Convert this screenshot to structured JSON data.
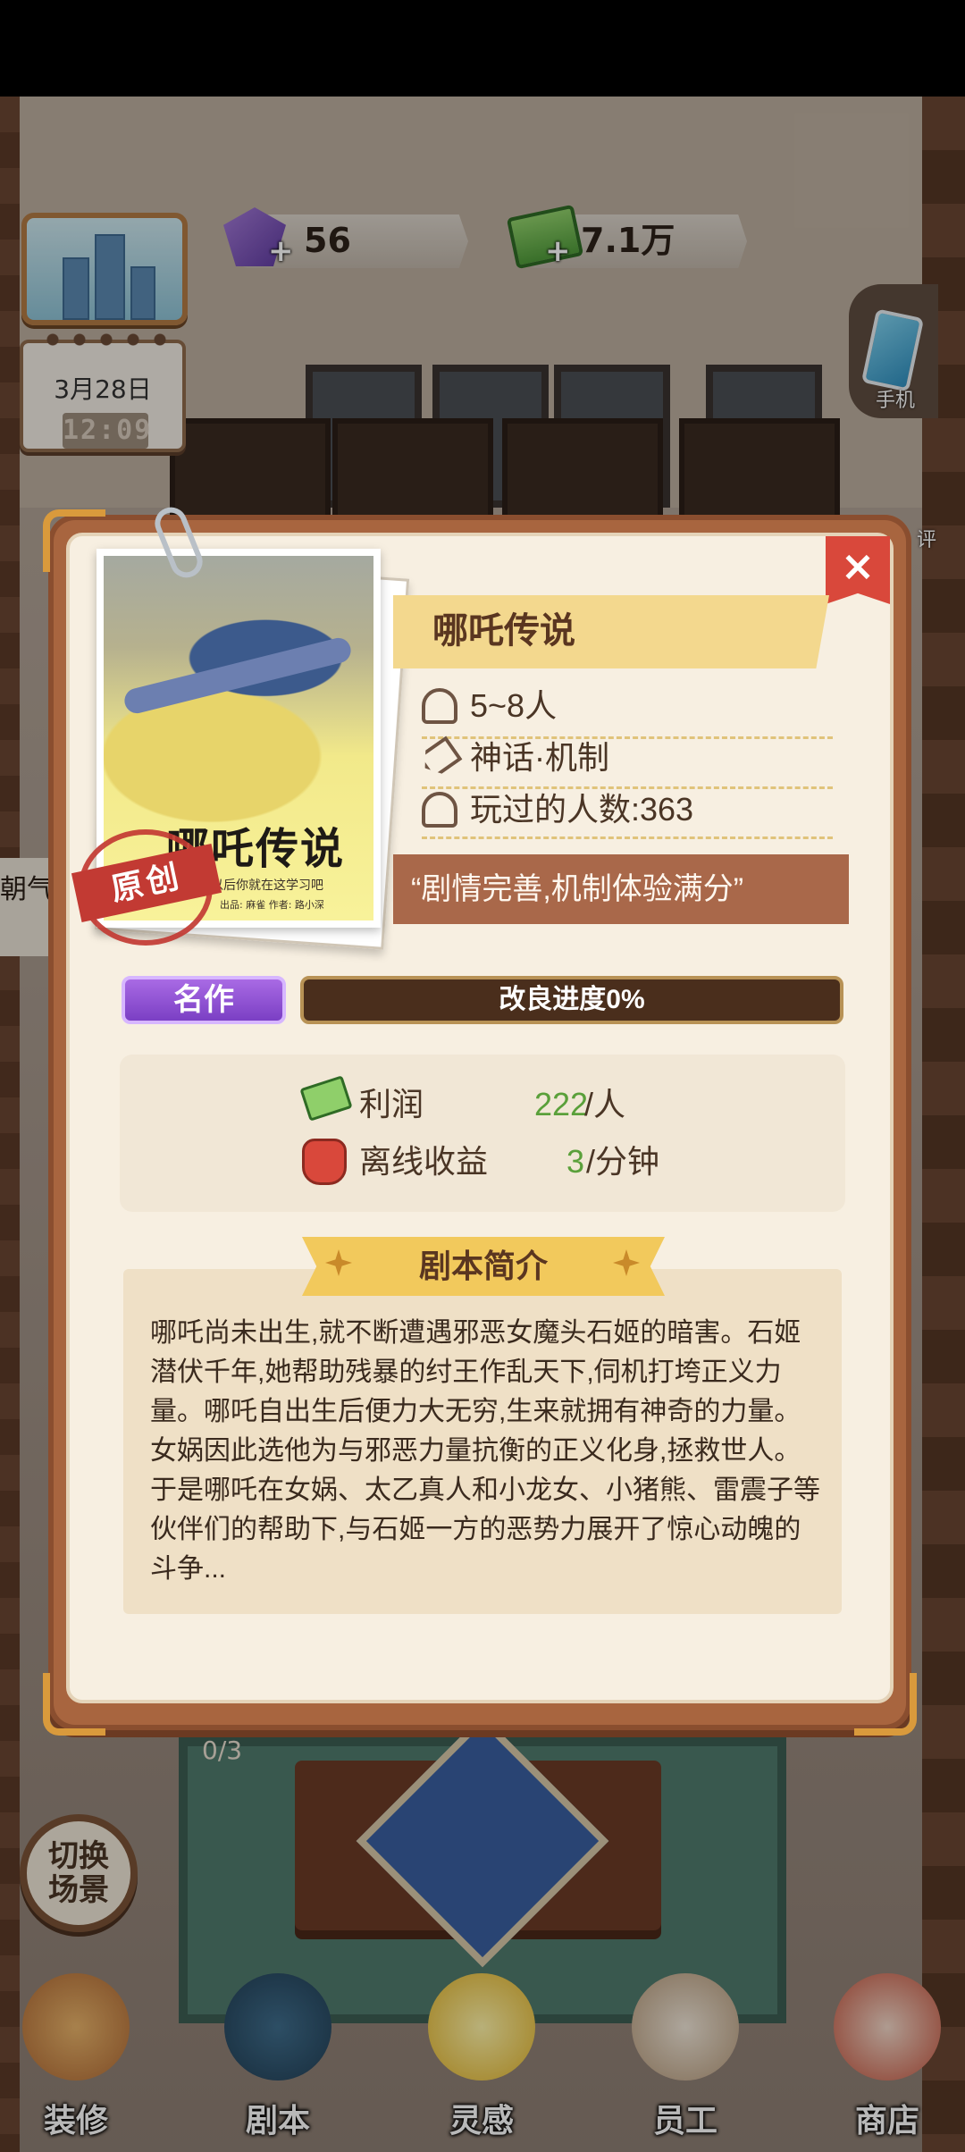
{
  "hud": {
    "gems": "56",
    "cash": "7.1万",
    "plus": "+"
  },
  "calendar": {
    "date": "3月28日",
    "time": "12:09"
  },
  "side": {
    "phone_label": "手机",
    "review_label": "评"
  },
  "scene": {
    "left_tag": "朝气",
    "seats": "0/3",
    "switch_scene": "切换场景"
  },
  "modal": {
    "close": "×",
    "book": {
      "title": "哪吒传说",
      "subtitle": "以后你就在这学习吧",
      "credits": "出品: 麻雀  作者: 路小深",
      "stamp": "原创"
    },
    "script_name": "哪吒传说",
    "players": "5~8人",
    "genre": "神话·机制",
    "play_count": "玩过的人数:363",
    "review": "“剧情完善,机制体验满分”",
    "badge": "名作",
    "improve_progress": "改良进度0%",
    "improve_fraction": 0,
    "profit_label": "利润",
    "profit_value": "222",
    "profit_unit": "/人",
    "offline_label": "离线收益",
    "offline_value": "3",
    "offline_unit": "/分钟",
    "synopsis_title": "剧本简介",
    "synopsis": "哪吒尚未出生,就不断遭遇邪恶女魔头石姬的暗害。石姬潜伏千年,她帮助残暴的纣王作乱天下,伺机打垮正义力量。哪吒自出生后便力大无穷,生来就拥有神奇的力量。女娲因此选他为与邪恶力量抗衡的正义化身,拯救世人。于是哪吒在女娲、太乙真人和小龙女、小猪熊、雷震子等伙伴们的帮助下,与石姬一方的恶势力展开了惊心动魄的斗争..."
  },
  "nav": {
    "items": [
      {
        "label": "装修",
        "icon": "house-icon"
      },
      {
        "label": "剧本",
        "icon": "script-book-icon"
      },
      {
        "label": "灵感",
        "icon": "lightbulb-icon"
      },
      {
        "label": "员工",
        "icon": "staff-badge-icon"
      },
      {
        "label": "商店",
        "icon": "shop-icon"
      }
    ]
  },
  "colors": {
    "modal_frame": "#a8653f",
    "badge_purple": "#7b3fc4",
    "close_red": "#d9483b",
    "value_green": "#5aa03a"
  }
}
